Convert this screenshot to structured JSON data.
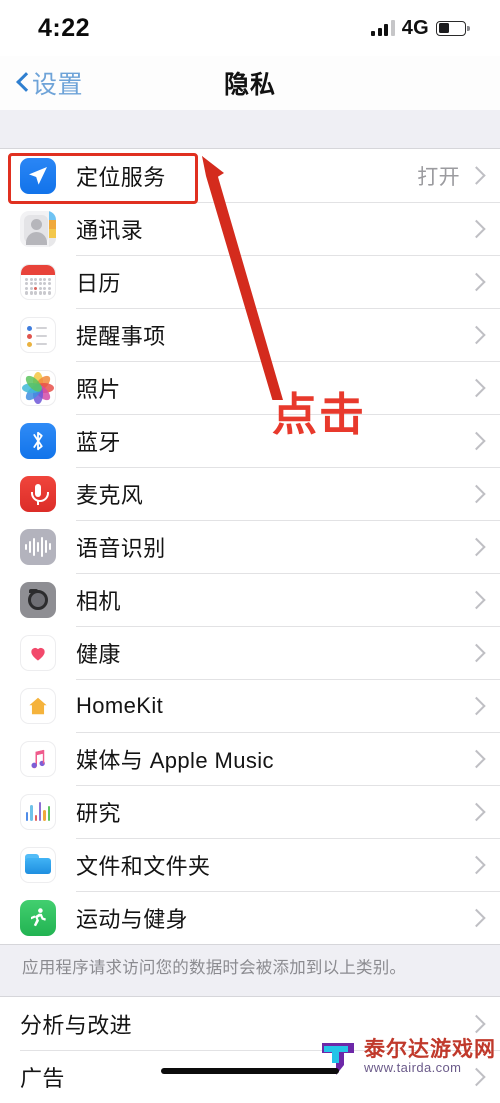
{
  "status_bar": {
    "time": "4:22",
    "network": "4G",
    "signal_icon": "signal-bars-icon",
    "battery_icon": "battery-icon",
    "battery_level_pct": 42
  },
  "nav": {
    "back_label": "设置",
    "back_icon": "chevron-left-icon",
    "title": "隐私"
  },
  "sections": [
    {
      "rows": [
        {
          "label": "定位服务",
          "value": "打开",
          "icon": "location-services-icon",
          "highlighted": true
        },
        {
          "label": "通讯录",
          "value": "",
          "icon": "contacts-icon"
        },
        {
          "label": "日历",
          "value": "",
          "icon": "calendar-icon"
        },
        {
          "label": "提醒事项",
          "value": "",
          "icon": "reminders-icon"
        },
        {
          "label": "照片",
          "value": "",
          "icon": "photos-icon"
        },
        {
          "label": "蓝牙",
          "value": "",
          "icon": "bluetooth-icon"
        },
        {
          "label": "麦克风",
          "value": "",
          "icon": "microphone-icon"
        },
        {
          "label": "语音识别",
          "value": "",
          "icon": "speech-recognition-icon"
        },
        {
          "label": "相机",
          "value": "",
          "icon": "camera-icon"
        },
        {
          "label": "健康",
          "value": "",
          "icon": "health-icon"
        },
        {
          "label": "HomeKit",
          "value": "",
          "icon": "homekit-icon"
        },
        {
          "label": "媒体与 Apple Music",
          "value": "",
          "icon": "apple-music-icon"
        },
        {
          "label": "研究",
          "value": "",
          "icon": "research-icon"
        },
        {
          "label": "文件和文件夹",
          "value": "",
          "icon": "files-and-folders-icon"
        },
        {
          "label": "运动与健身",
          "value": "",
          "icon": "fitness-icon"
        }
      ],
      "footer": "应用程序请求访问您的数据时会被添加到以上类别。"
    },
    {
      "rows": [
        {
          "label": "分析与改进",
          "value": ""
        },
        {
          "label": "广告",
          "value": ""
        }
      ]
    }
  ],
  "annotation": {
    "callout_text": "点击",
    "highlight_color": "#e03020",
    "arrow_color": "#d42b1d",
    "text_color": "#e8392c"
  },
  "watermark": {
    "site_name": "泰尔达游戏网",
    "url": "www.tairda.com"
  }
}
